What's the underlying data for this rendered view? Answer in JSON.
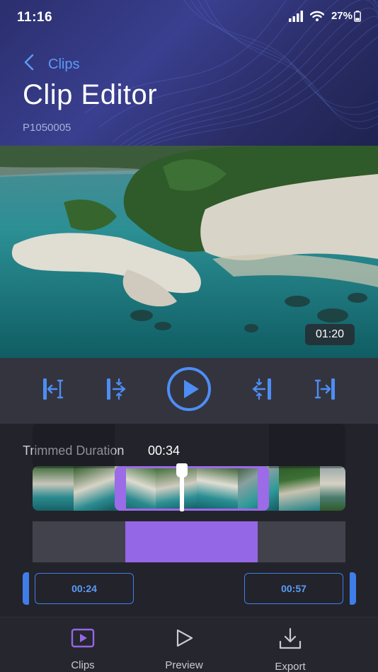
{
  "status_bar": {
    "time": "11:16",
    "battery": "27%"
  },
  "header": {
    "back_label": "Clips",
    "title": "Clip Editor",
    "clip_id": "P1050005"
  },
  "video": {
    "current_time": "01:20"
  },
  "controls": {
    "icons": [
      "trim-start-icon",
      "split-before-icon",
      "play-icon",
      "split-after-icon",
      "trim-end-icon"
    ]
  },
  "trim": {
    "duration_label": "Trimmed Duration",
    "duration_value": "00:34",
    "start_time": "00:24",
    "end_time": "00:57"
  },
  "tabs": [
    {
      "label": "Clips",
      "icon": "clips-icon",
      "active": true
    },
    {
      "label": "Preview",
      "icon": "preview-icon",
      "active": false
    },
    {
      "label": "Export",
      "icon": "export-icon",
      "active": false
    }
  ],
  "colors": {
    "accent_blue": "#3f7ee8",
    "accent_purple": "#9467e6",
    "header": "#2f3478"
  }
}
